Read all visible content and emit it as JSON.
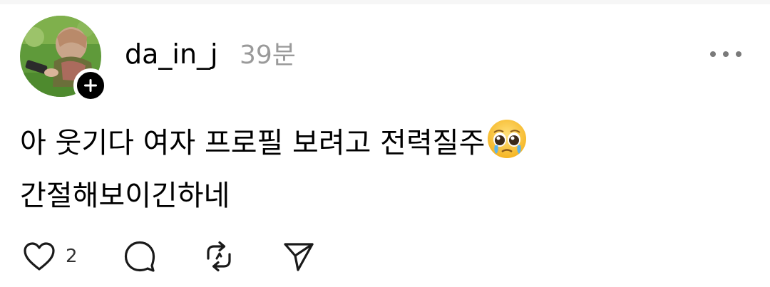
{
  "post": {
    "author": {
      "username": "da_in_j",
      "avatar_icon": "avatar-photo",
      "follow_icon": "plus-icon"
    },
    "timestamp": "39분",
    "more_icon": "more-horizontal-icon",
    "text_lines": [
      "아 웃기다 여자 프로필 보려고 전력질주",
      "간절해보이긴하네"
    ],
    "emoji": "pleading-face-with-tears-emoji",
    "actions": {
      "like": {
        "icon": "heart-icon",
        "count": "2"
      },
      "comment": {
        "icon": "comment-icon"
      },
      "repost": {
        "icon": "repost-icon"
      },
      "share": {
        "icon": "send-icon"
      }
    }
  },
  "colors": {
    "text": "#000000",
    "muted": "#9a9a9a",
    "icon": "#1a1a1a"
  }
}
